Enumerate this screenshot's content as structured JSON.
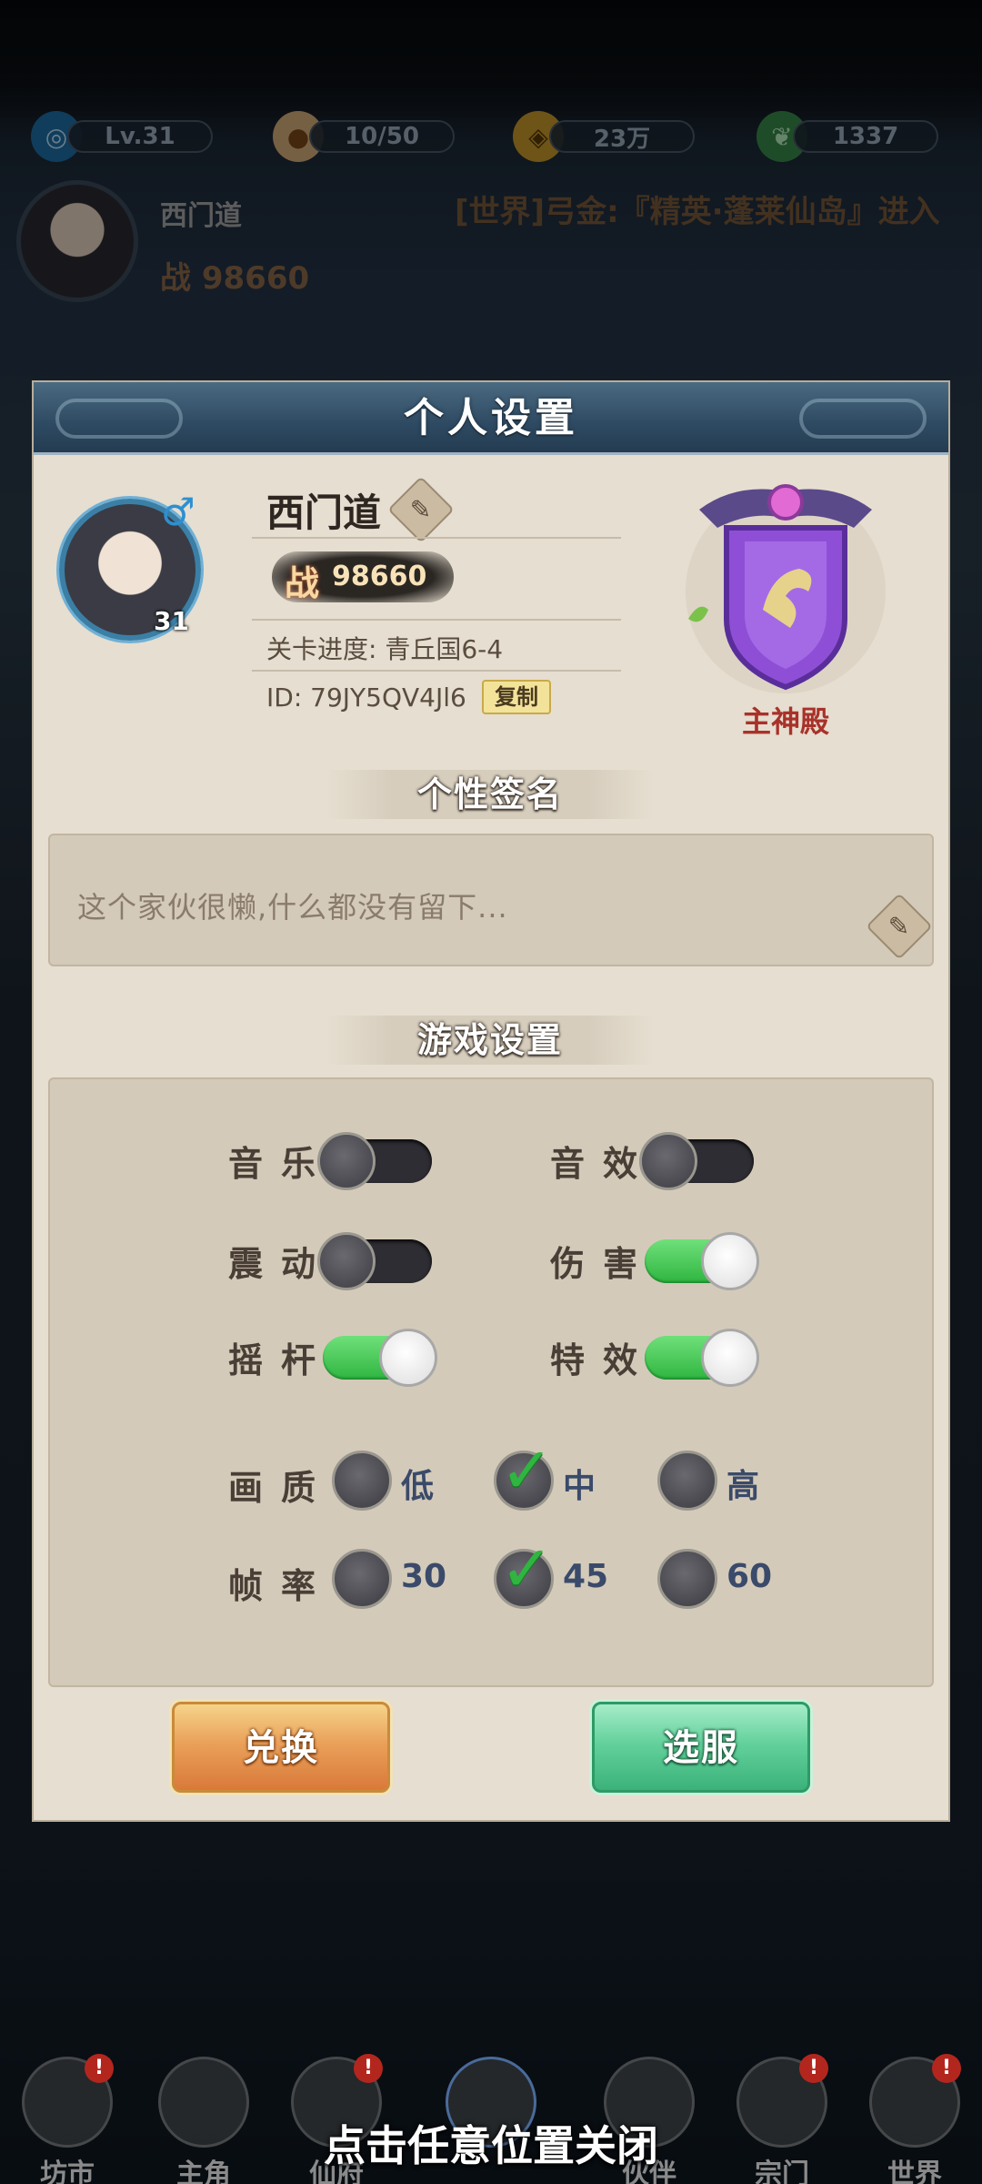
{
  "hud": {
    "resources": [
      {
        "icon": "spiral-icon",
        "value": "Lv.31"
      },
      {
        "icon": "bun-icon",
        "value": "10/50"
      },
      {
        "icon": "coin-icon",
        "value": "23万"
      },
      {
        "icon": "leaf-icon",
        "value": "1337"
      }
    ],
    "player_name": "西门道",
    "power_label": "战",
    "power_value": "98660",
    "chat_message": "[世界]弓金:『精英·蓬莱仙岛』进入"
  },
  "panel": {
    "title": "个人设置",
    "profile": {
      "name": "西门道",
      "level": "31",
      "gender_icon": "male-icon",
      "power_label": "战",
      "power_value": "98660",
      "stage_text": "关卡进度: 青丘国6-4",
      "id_text": "ID: 79JY5QV4Jl6",
      "copy_label": "复制",
      "guild_name": "主神殿"
    },
    "signature": {
      "section_title": "个性签名",
      "text": "这个家伙很懒,什么都没有留下..."
    },
    "game_settings": {
      "section_title": "游戏设置",
      "toggles": [
        {
          "label": "音乐",
          "on": false
        },
        {
          "label": "音效",
          "on": false
        },
        {
          "label": "震动",
          "on": false
        },
        {
          "label": "伤害",
          "on": true
        },
        {
          "label": "摇杆",
          "on": true
        },
        {
          "label": "特效",
          "on": true
        }
      ],
      "quality": {
        "label": "画质",
        "options": [
          "低",
          "中",
          "高"
        ],
        "selected": "中"
      },
      "framerate": {
        "label": "帧率",
        "options": [
          "30",
          "45",
          "60"
        ],
        "selected": "45"
      }
    },
    "buttons": {
      "exchange": "兑换",
      "select_server": "选服"
    }
  },
  "bottom_nav": [
    {
      "label": "坊市",
      "badge": "!"
    },
    {
      "label": "主角",
      "badge": ""
    },
    {
      "label": "仙府",
      "badge": "!"
    },
    {
      "label": "",
      "badge": ""
    },
    {
      "label": "伙伴",
      "badge": ""
    },
    {
      "label": "宗门",
      "badge": "!"
    },
    {
      "label": "世界",
      "badge": "!"
    }
  ],
  "close_hint": "点击任意位置关闭",
  "colors": {
    "panel_bg": "#e6ded0",
    "toggle_on": "#2fb540",
    "toggle_off": "#2e2d33",
    "header": "#2e4a62",
    "guild_text": "#a8322a"
  }
}
